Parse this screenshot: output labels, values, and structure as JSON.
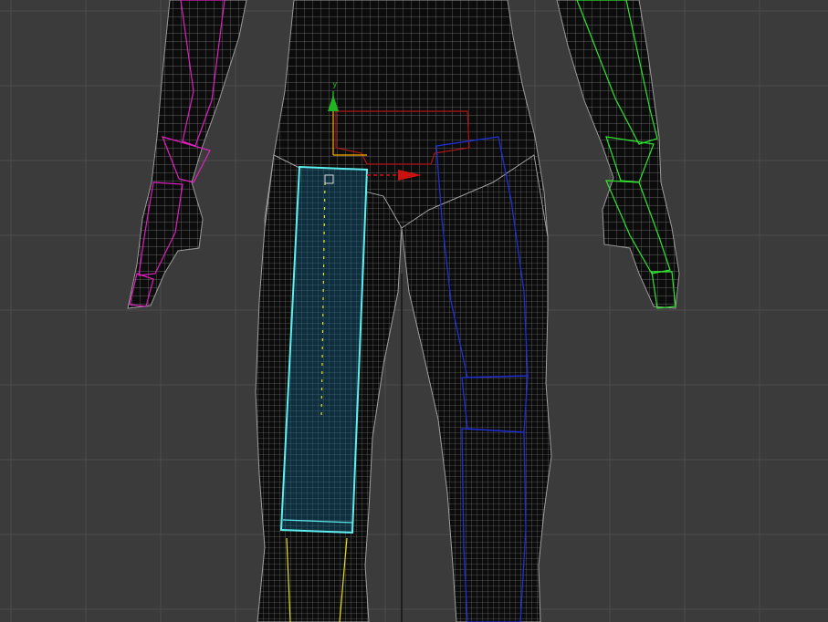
{
  "viewport": {
    "background": "#3b3b3b",
    "grid_color": "#4d4d4d",
    "axis_line_color": "#0a0a0a",
    "mesh_fill": "#0c0c0c",
    "mesh_wire": "#7d7d7d",
    "gizmo": {
      "y_axis_label": "y",
      "y_axis_color": "#22b322",
      "x_axis_color": "#cc1111",
      "link_color": "#ffb000"
    },
    "bones": {
      "left_arm_color": "#e020c0",
      "right_arm_color": "#2ee62e",
      "pelvis_color": "#b01515",
      "selected_thigh_color": "#5ef0f0",
      "selected_thigh_fill": "#0f2f3f",
      "right_leg_color": "#1f2fd6",
      "calf_color": "#e8e020"
    }
  }
}
